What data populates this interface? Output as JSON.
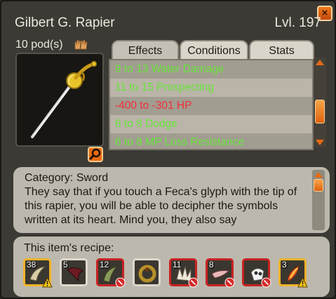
{
  "window": {
    "title": "Gilbert G. Rapier",
    "level": "Lvl. 197",
    "close_label": "×"
  },
  "item": {
    "pods": "10 pod(s)",
    "weight_icon": "hands-icon"
  },
  "tabs": [
    {
      "label": "Effects",
      "active": true
    },
    {
      "label": "Conditions",
      "active": false
    },
    {
      "label": "Stats",
      "active": false
    }
  ],
  "effects": [
    {
      "text": "9 to 13 Water Damage",
      "kind": "positive"
    },
    {
      "text": "11 to 15 Prospecting",
      "kind": "positive"
    },
    {
      "text": "-400 to -301 HP",
      "kind": "negative"
    },
    {
      "text": "6 to 8 Dodge",
      "kind": "positive"
    },
    {
      "text": "6 to 8 MP Loss Resistance",
      "kind": "positive"
    }
  ],
  "colors": {
    "positive": "#67e43a",
    "negative": "#ef2f3a",
    "accent": "#e76b12"
  },
  "description": {
    "category": "Category: Sword",
    "text": "They say that if you touch a Feca's glyph with the tip of this rapier, you will be able to decipher the symbols written at its heart. Mind you, they also say"
  },
  "recipe": {
    "title": "This item's recipe:",
    "ingredients": [
      {
        "qty": "38",
        "status": "warn",
        "icon": "bone-horn-icon"
      },
      {
        "qty": "5",
        "status": "ok",
        "icon": "dark-fang-icon"
      },
      {
        "qty": "12",
        "status": "missing",
        "icon": "tusk-icon"
      },
      {
        "qty": "",
        "status": "ok",
        "icon": "ring-icon"
      },
      {
        "qty": "11",
        "status": "missing",
        "icon": "claw-icon"
      },
      {
        "qty": "8",
        "status": "missing",
        "icon": "blade-fragment-icon"
      },
      {
        "qty": "",
        "status": "missing",
        "icon": "skull-icon"
      },
      {
        "qty": "3",
        "status": "warn",
        "icon": "feather-icon"
      }
    ]
  }
}
